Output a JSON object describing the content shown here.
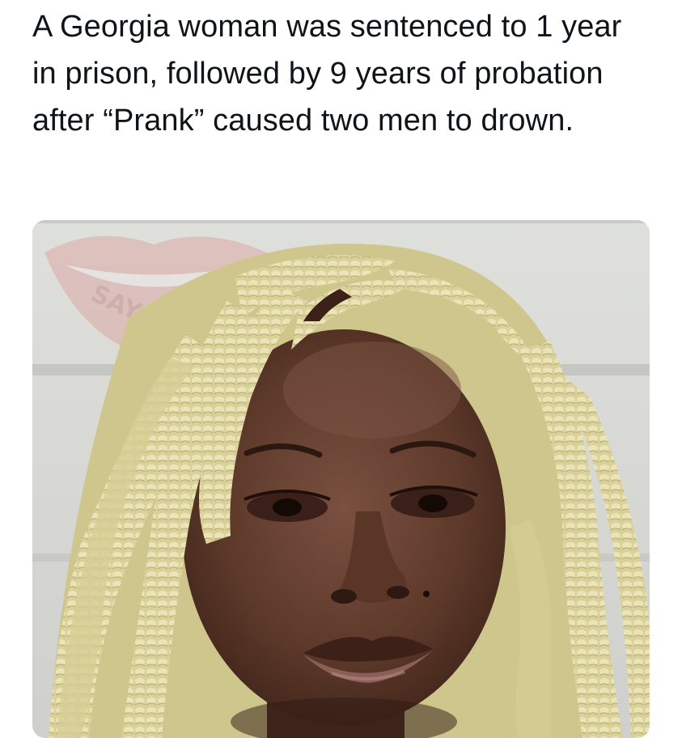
{
  "tweet": {
    "text": "A Georgia woman was sentenced to 1 year in prison, followed by 9 years of probation after “Prank” caused two men to drown."
  },
  "media": {
    "description_icon": "mugshot-photo",
    "watermark_text": "SAY C",
    "colors": {
      "wall": "#d8d9d5",
      "mortar": "#c4c6c2",
      "skin": "#5a3a2a",
      "braids": "#d8cf98"
    }
  }
}
